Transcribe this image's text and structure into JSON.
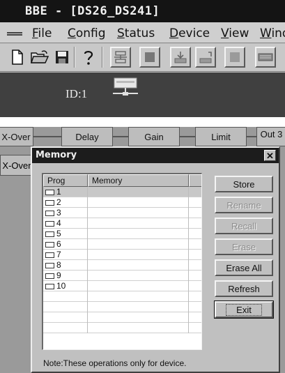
{
  "app": {
    "title": "BBE - [DS26_DS241]",
    "menu": [
      {
        "label": "File",
        "mnemonic": "F",
        "rest": "ile"
      },
      {
        "label": "Config",
        "mnemonic": "C",
        "rest": "onfig"
      },
      {
        "label": "Status",
        "mnemonic": "S",
        "rest": "tatus"
      },
      {
        "label": "Device",
        "mnemonic": "D",
        "rest": "evice"
      },
      {
        "label": "View",
        "mnemonic": "V",
        "rest": "iew"
      },
      {
        "label": "Window",
        "mnemonic": "W",
        "rest": "ind"
      }
    ],
    "toolbar_icons": [
      "new-file-icon",
      "open-folder-icon",
      "save-icon",
      "help-icon",
      "network-icon",
      "record-icon",
      "download-icon",
      "upload-icon",
      "square-icon",
      "keyboard-icon"
    ],
    "device_label": "ID:1"
  },
  "tabs": [
    "X-Over",
    "Delay",
    "Gain",
    "Limit",
    "Out 3"
  ],
  "tab_second_row": "X-Over",
  "dialog": {
    "title": "Memory",
    "columns": [
      "Prog",
      "Memory"
    ],
    "rows": [
      {
        "prog": "1",
        "memory": ""
      },
      {
        "prog": "2",
        "memory": ""
      },
      {
        "prog": "3",
        "memory": ""
      },
      {
        "prog": "4",
        "memory": ""
      },
      {
        "prog": "5",
        "memory": ""
      },
      {
        "prog": "6",
        "memory": ""
      },
      {
        "prog": "7",
        "memory": ""
      },
      {
        "prog": "8",
        "memory": ""
      },
      {
        "prog": "9",
        "memory": ""
      },
      {
        "prog": "10",
        "memory": ""
      }
    ],
    "buttons": {
      "store": "Store",
      "rename": "Rename",
      "recall": "Recall",
      "erase": "Erase",
      "erase_all": "Erase All",
      "refresh": "Refresh",
      "exit": "Exit"
    },
    "note": "Note:These operations only for device."
  }
}
